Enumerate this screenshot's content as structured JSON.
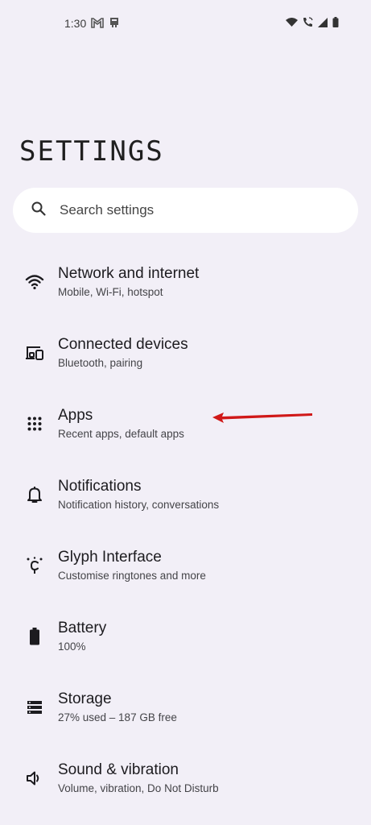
{
  "status_bar": {
    "time": "1:30",
    "left_icons": [
      "gmail-icon",
      "notification-app-icon"
    ],
    "right_icons": [
      "wifi-icon",
      "wifi-calling-icon",
      "signal-icon",
      "battery-icon"
    ]
  },
  "page": {
    "title": "SETTINGS"
  },
  "search": {
    "placeholder": "Search settings"
  },
  "settings": {
    "items": [
      {
        "title": "Network and internet",
        "subtitle": "Mobile, Wi-Fi, hotspot",
        "icon": "wifi-icon"
      },
      {
        "title": "Connected devices",
        "subtitle": "Bluetooth, pairing",
        "icon": "connected-devices-icon"
      },
      {
        "title": "Apps",
        "subtitle": "Recent apps, default apps",
        "icon": "apps-grid-icon"
      },
      {
        "title": "Notifications",
        "subtitle": "Notification history, conversations",
        "icon": "bell-icon"
      },
      {
        "title": "Glyph Interface",
        "subtitle": "Customise ringtones and more",
        "icon": "glyph-icon"
      },
      {
        "title": "Battery",
        "subtitle": "100%",
        "icon": "battery-icon"
      },
      {
        "title": "Storage",
        "subtitle": "27% used – 187 GB free",
        "icon": "storage-icon"
      },
      {
        "title": "Sound & vibration",
        "subtitle": "Volume, vibration, Do Not Disturb",
        "icon": "volume-icon"
      }
    ]
  },
  "annotation": {
    "arrow_color": "#d01818",
    "points_to": "Apps"
  },
  "colors": {
    "background": "#f2eff7",
    "search_background": "#ffffff",
    "text_primary": "#1c1b1f",
    "text_secondary": "#444448"
  }
}
